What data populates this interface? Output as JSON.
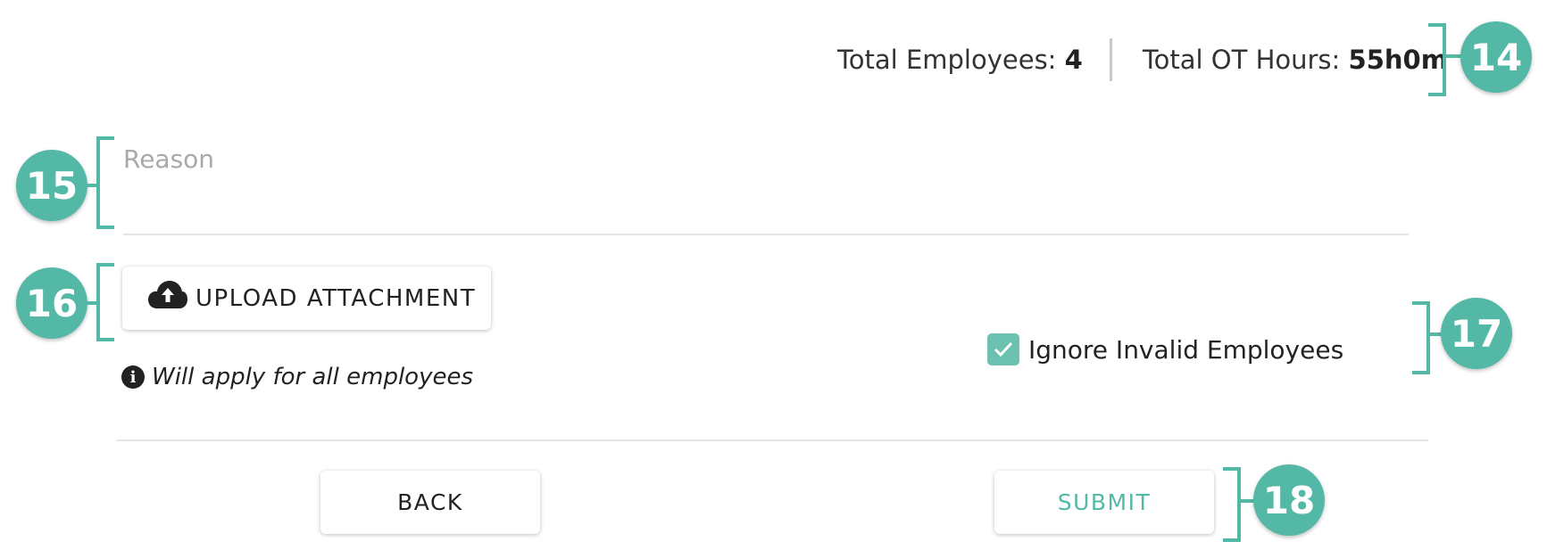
{
  "summary": {
    "employees_label": "Total Employees:",
    "employees_value": "4",
    "ot_label": "Total OT Hours:",
    "ot_value": "55h0m"
  },
  "form": {
    "reason_placeholder": "Reason",
    "upload_label": "UPLOAD ATTACHMENT",
    "upload_icon": "cloud-upload-icon",
    "hint_icon": "info-icon",
    "hint_text": "Will apply for all employees",
    "ignore_invalid_label": "Ignore Invalid Employees",
    "ignore_invalid_checked": true
  },
  "actions": {
    "back_label": "BACK",
    "submit_label": "SUBMIT"
  },
  "annotations": [
    "14",
    "15",
    "16",
    "17",
    "18"
  ],
  "colors": {
    "accent": "#54b8a6",
    "checkbox": "#6cc0b0",
    "text": "#222222",
    "placeholder": "#a9a9a9",
    "divider": "#e5e5e5"
  }
}
